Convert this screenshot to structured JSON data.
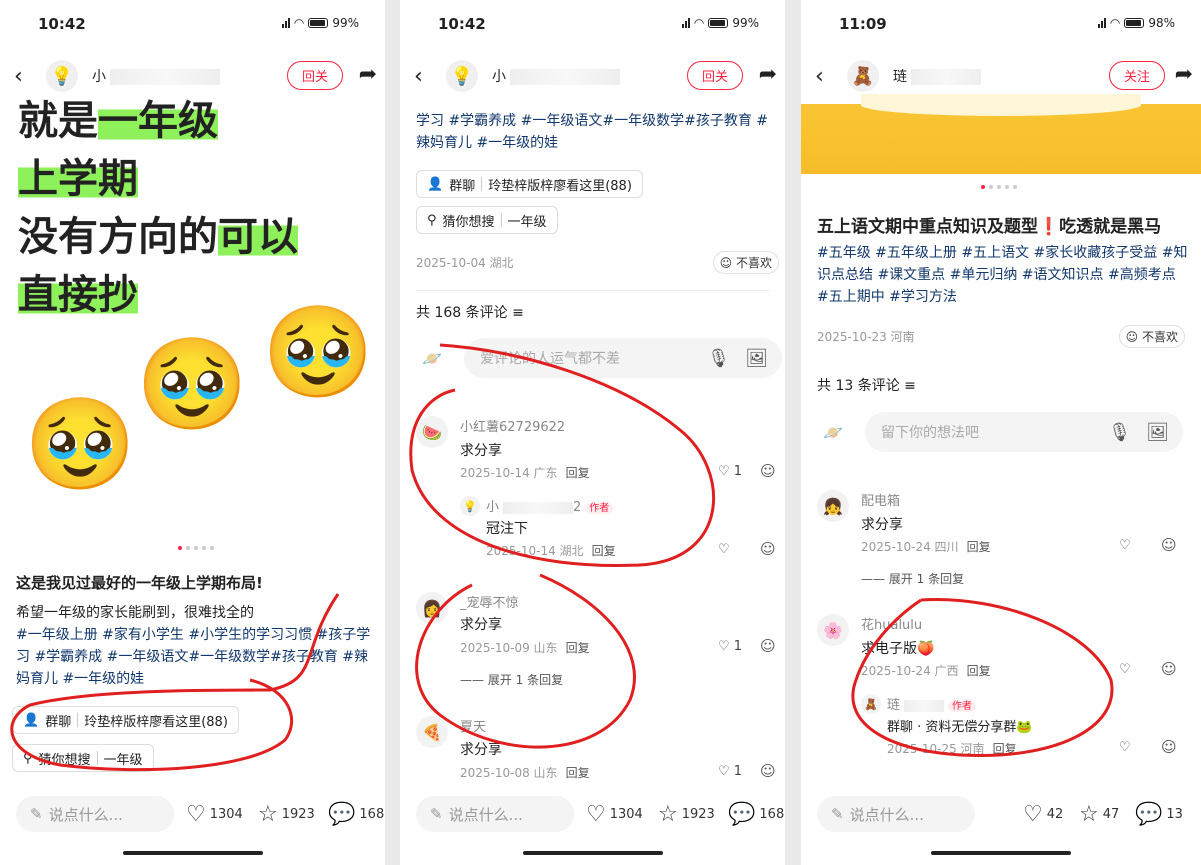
{
  "panels": [
    {
      "status": {
        "time": "10:42",
        "battery": "99%"
      },
      "topbar": {
        "name": "小",
        "follow": "回关"
      },
      "poster_lines": [
        {
          "plain": "就是",
          "hl": "一年级"
        },
        {
          "plain": "",
          "hl": "上学期"
        },
        {
          "plain": "没有方向的",
          "hl": "可以"
        },
        {
          "plain": "",
          "hl": "直接抄"
        }
      ],
      "title": "这是我见过最好的一年级上学期布局!",
      "desc_text": "希望一年级的家长能刷到，很难找全的",
      "tags_1": "#一年级上册 #家有小学生 #小学生的学习习惯 #孩子学习 #学霸养成 #一年级语文#一年级数学#孩子教育 #辣妈育儿 #一年级的娃",
      "group_chat": {
        "label": "群聊",
        "text": "玲垫梓版梓廖看这里(88)"
      },
      "guess": {
        "label": "猜你想搜",
        "text": "一年级"
      },
      "bottom": {
        "placeholder": "说点什么...",
        "likes": "1304",
        "stars": "1923",
        "comments": "168"
      }
    },
    {
      "status": {
        "time": "10:42",
        "battery": "99%"
      },
      "topbar": {
        "name": "小",
        "follow": "回关"
      },
      "tags_top": "学习 #学霸养成 #一年级语文#一年级数学#孩子教育 #辣妈育儿 #一年级的娃",
      "group_chat": {
        "label": "群聊",
        "text": "玲垫梓版梓廖看这里(88)"
      },
      "guess": {
        "label": "猜你想搜",
        "text": "一年级"
      },
      "meta": "2025-10-04 湖北",
      "dislike": "不喜欢",
      "comment_count": "共 168 条评论",
      "input_placeholder": "爱评论的人运气都不差",
      "comments": [
        {
          "name": "小红薯62729622",
          "text": "求分享",
          "meta": "2025-10-14 广东",
          "reply": "回复",
          "likes": "1"
        },
        {
          "name": "小",
          "name_tail": "2",
          "author": "作者",
          "text": "冠注下",
          "meta": "2025-10-14 湖北",
          "reply": "回复"
        },
        {
          "name": "_宠辱不惊",
          "text": "求分享",
          "meta": "2025-10-09 山东",
          "reply": "回复",
          "likes": "1",
          "expand": "展开 1 条回复"
        },
        {
          "name": "夏天",
          "text": "求分享",
          "meta": "2025-10-08 山东",
          "reply": "回复",
          "likes": "1"
        }
      ],
      "bottom": {
        "placeholder": "说点什么...",
        "likes": "1304",
        "stars": "1923",
        "comments": "168"
      }
    },
    {
      "status": {
        "time": "11:09",
        "battery": "98%"
      },
      "topbar": {
        "name": "琏",
        "follow": "关注"
      },
      "title": "五上语文期中重点知识及题型❗吃透就是黑马",
      "tags": "#五年级 #五年级上册 #五上语文 #家长收藏孩子受益 #知识点总结 #课文重点 #单元归纳 #语文知识点 #高频考点 #五上期中 #学习方法",
      "meta": "2025-10-23 河南",
      "dislike": "不喜欢",
      "comment_count": "共 13 条评论",
      "input_placeholder": "留下你的想法吧",
      "comments": [
        {
          "name": "配电箱",
          "text": "求分享",
          "meta": "2025-10-24 四川",
          "reply": "回复",
          "expand": "展开 1 条回复"
        },
        {
          "name": "花hualulu",
          "text": "求电子版🍑",
          "meta": "2025-10-24 广西",
          "reply": "回复"
        },
        {
          "name": "琏",
          "author": "作者",
          "text": "群聊 · 资料无偿分享群🐸",
          "meta": "2025-10-25 河南",
          "reply": "回复"
        }
      ],
      "bottom": {
        "placeholder": "说点什么...",
        "likes": "42",
        "stars": "47",
        "comments": "13"
      }
    }
  ],
  "colors": {
    "accent": "#ff2442",
    "tag": "#13386c",
    "highlight": "#8ef05a",
    "ink": "#e02020"
  }
}
